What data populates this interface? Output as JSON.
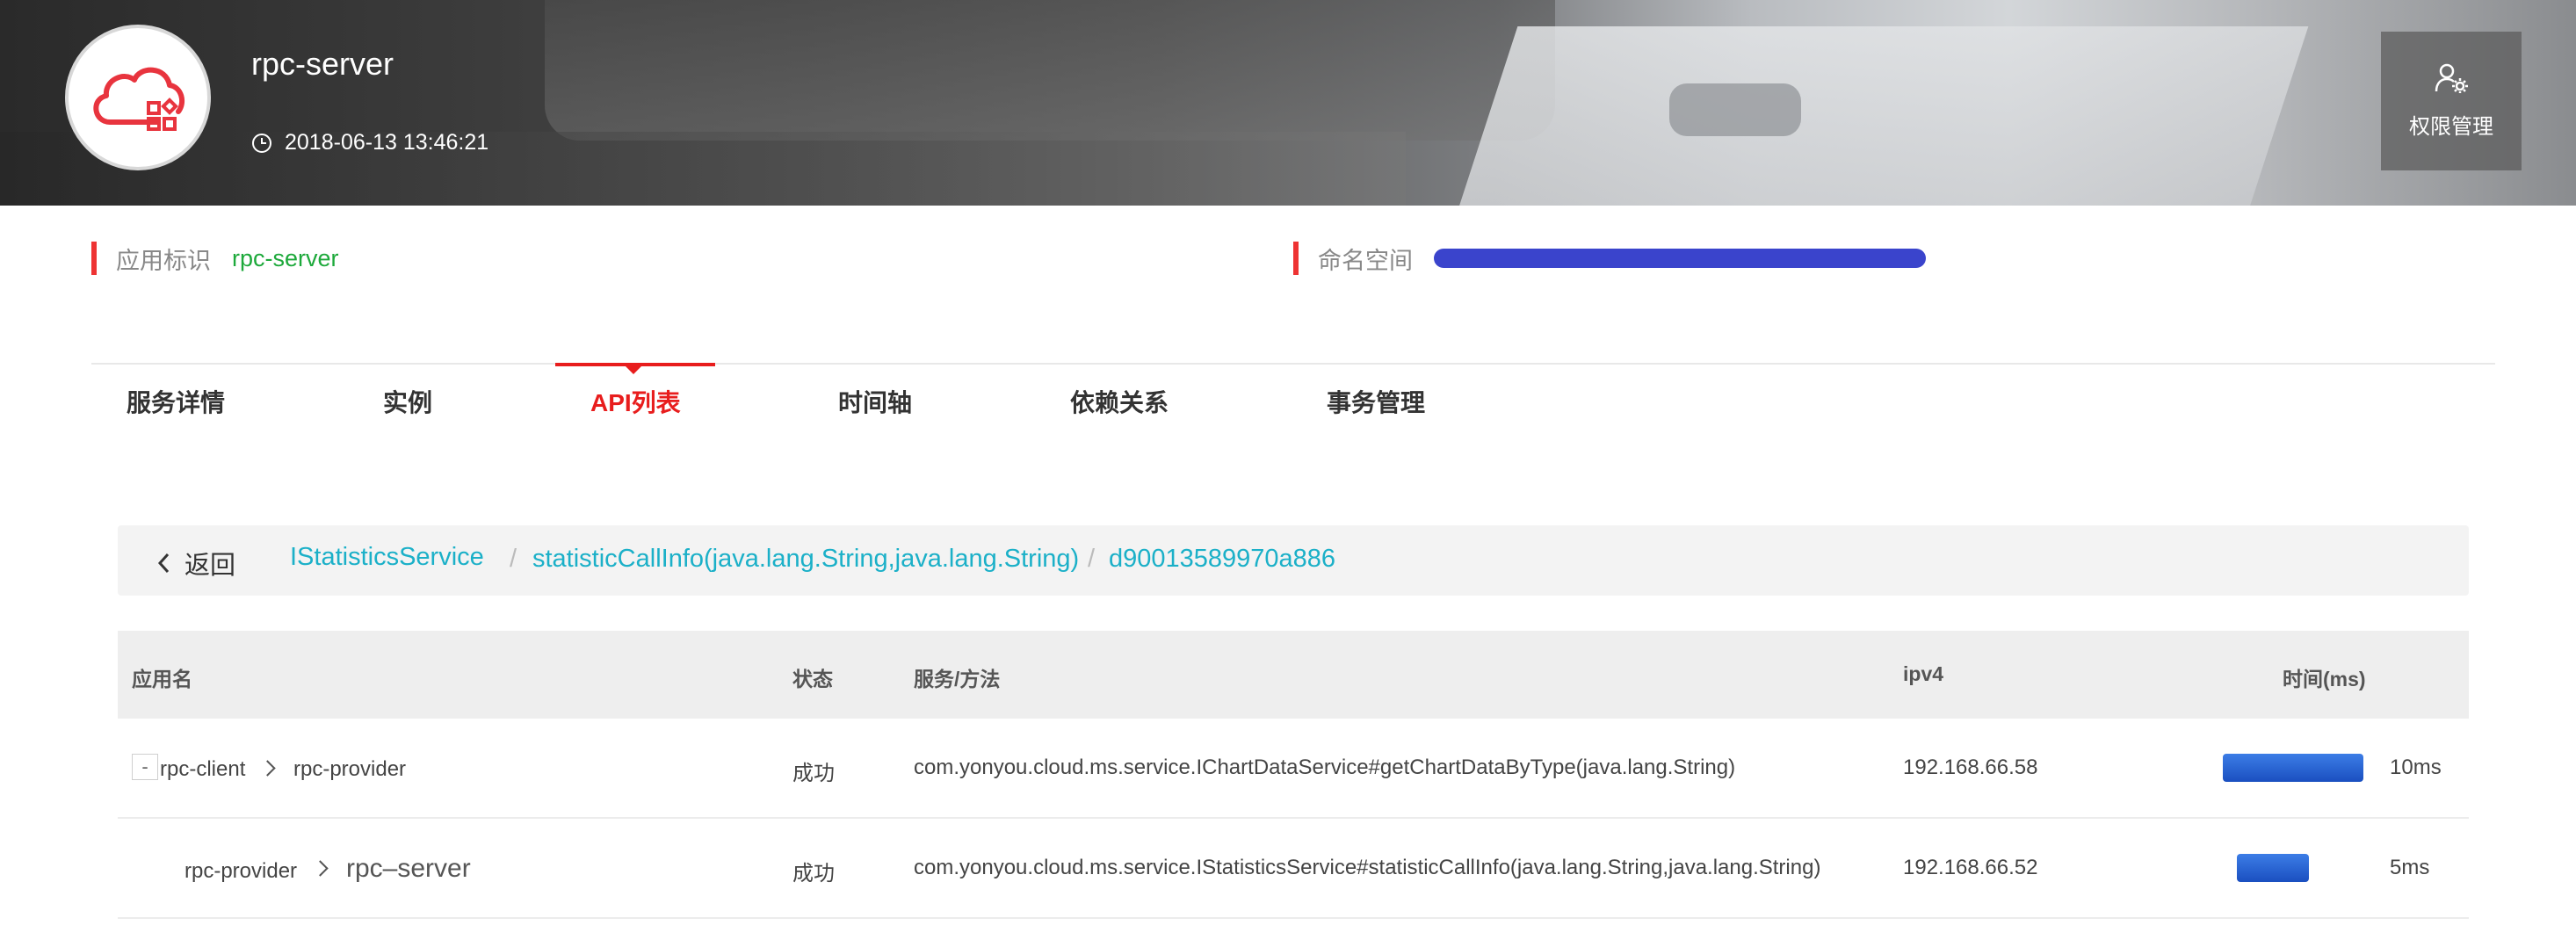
{
  "header": {
    "app_name": "rpc-server",
    "timestamp": "2018-06-13 13:46:21",
    "permission_button": "权限管理"
  },
  "info": {
    "app_id_label": "应用标识",
    "app_id_value": "rpc-server",
    "namespace_label": "命名空间"
  },
  "tabs": [
    "服务详情",
    "实例",
    "API列表",
    "时间轴",
    "依赖关系",
    "事务管理"
  ],
  "active_tab": "API列表",
  "breadcrumb": {
    "back_label": "返回",
    "items": [
      "IStatisticsService",
      "statisticCallInfo(java.lang.String,java.lang.String)",
      "d90013589970a886"
    ],
    "separator": "/"
  },
  "table": {
    "columns": [
      "应用名",
      "状态",
      "服务/方法",
      "ipv4",
      "时间(ms)"
    ],
    "rows": [
      {
        "toggle": "-",
        "from": "rpc-client",
        "to": "rpc-provider",
        "status": "成功",
        "method": "com.yonyou.cloud.ms.service.IChartDataService#getChartDataByType(java.lang.String)",
        "ipv4": "192.168.66.58",
        "time": "10ms",
        "time_ms": 10
      },
      {
        "from": "rpc-provider",
        "to": "rpc–server",
        "status": "成功",
        "method": "com.yonyou.cloud.ms.service.IStatisticsService#statisticCallInfo(java.lang.String,java.lang.String)",
        "ipv4": "192.168.66.52",
        "time": "5ms",
        "time_ms": 5
      }
    ]
  },
  "colors": {
    "accent_red": "#e81d1d",
    "success_green": "#1da93b",
    "link_cyan": "#1bb0c8",
    "bar_blue": "#2a63d4"
  }
}
